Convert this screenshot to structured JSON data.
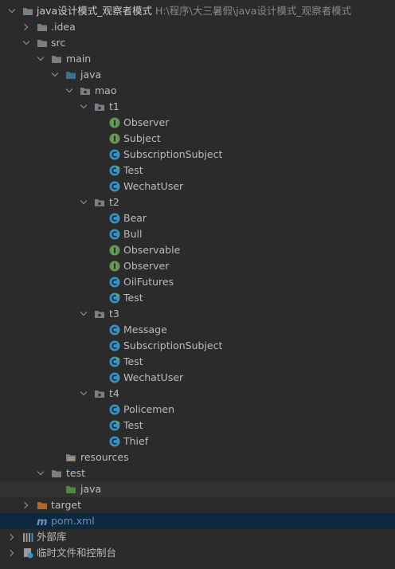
{
  "project": {
    "name": "java设计模式_观察者模式",
    "path": "H:\\程序\\大三暑假\\java设计模式_观察者模式"
  },
  "folders": {
    "idea": ".idea",
    "src": "src",
    "main": "main",
    "java": "java",
    "mao": "mao",
    "resources": "resources",
    "test": "test",
    "test_java": "java",
    "target": "target"
  },
  "packages": {
    "t1": "t1",
    "t2": "t2",
    "t3": "t3",
    "t4": "t4"
  },
  "t1_files": [
    "Observer",
    "Subject",
    "SubscriptionSubject",
    "Test",
    "WechatUser"
  ],
  "t2_files": [
    "Bear",
    "Bull",
    "Observable",
    "Observer",
    "OilFutures",
    "Test"
  ],
  "t3_files": [
    "Message",
    "SubscriptionSubject",
    "Test",
    "WechatUser"
  ],
  "t4_files": [
    "Policemen",
    "Test",
    "Thief"
  ],
  "pom": "pom.xml",
  "external_libs": "外部库",
  "scratches": "临时文件和控制台",
  "colors": {
    "background": "#2b2b2b",
    "folder": "#7a7e85",
    "source_folder": "#3d6f8f",
    "test_folder": "#4d8a3f",
    "target_folder": "#b0652a",
    "class_icon": "#3592c4",
    "interface_icon": "#629755",
    "pom_text": "#6c8fc7"
  }
}
